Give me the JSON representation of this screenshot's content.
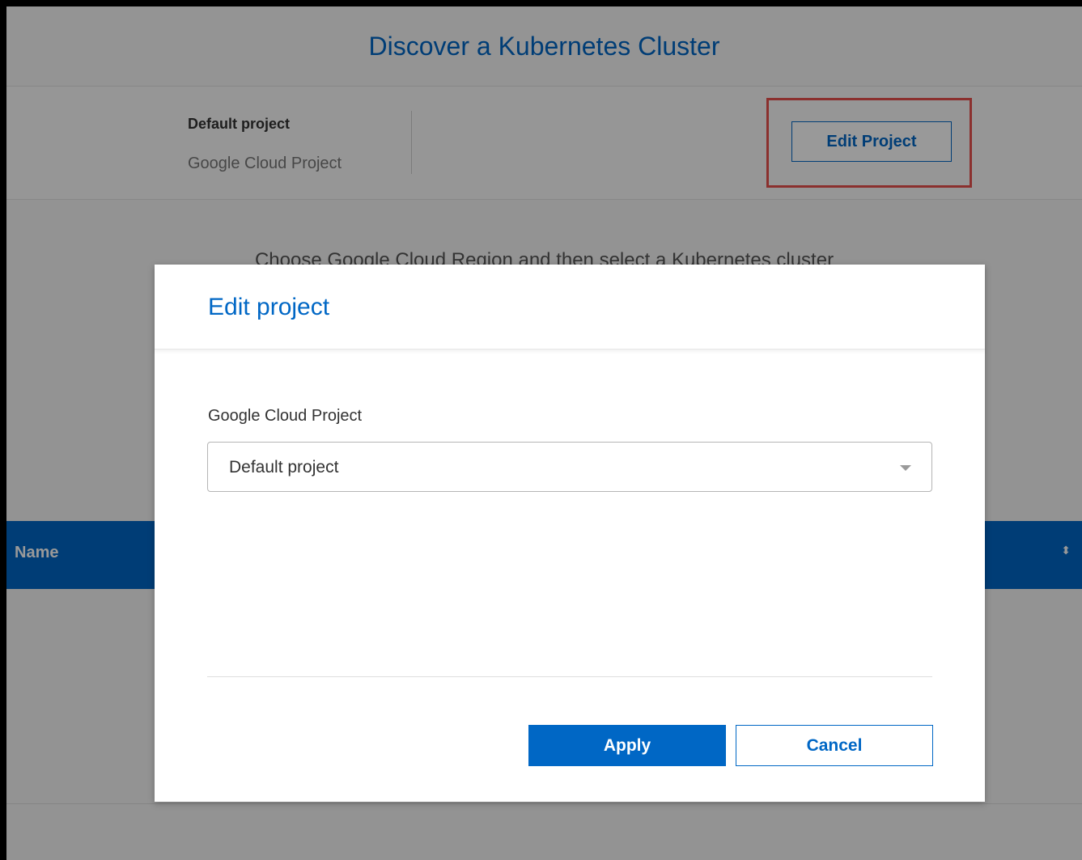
{
  "page": {
    "title": "Discover a Kubernetes Cluster",
    "region_instruction": "Choose Google Cloud Region and then select a Kubernetes cluster"
  },
  "project_bar": {
    "project_name": "Default project",
    "project_type": "Google Cloud Project",
    "edit_button": "Edit Project"
  },
  "table": {
    "header_name": "Name",
    "sort_icon": "⬍"
  },
  "modal": {
    "title": "Edit project",
    "field_label": "Google Cloud Project",
    "selected_value": "Default project",
    "apply_label": "Apply",
    "cancel_label": "Cancel"
  },
  "colors": {
    "accent": "#0067c5",
    "highlight": "#e8514d"
  }
}
